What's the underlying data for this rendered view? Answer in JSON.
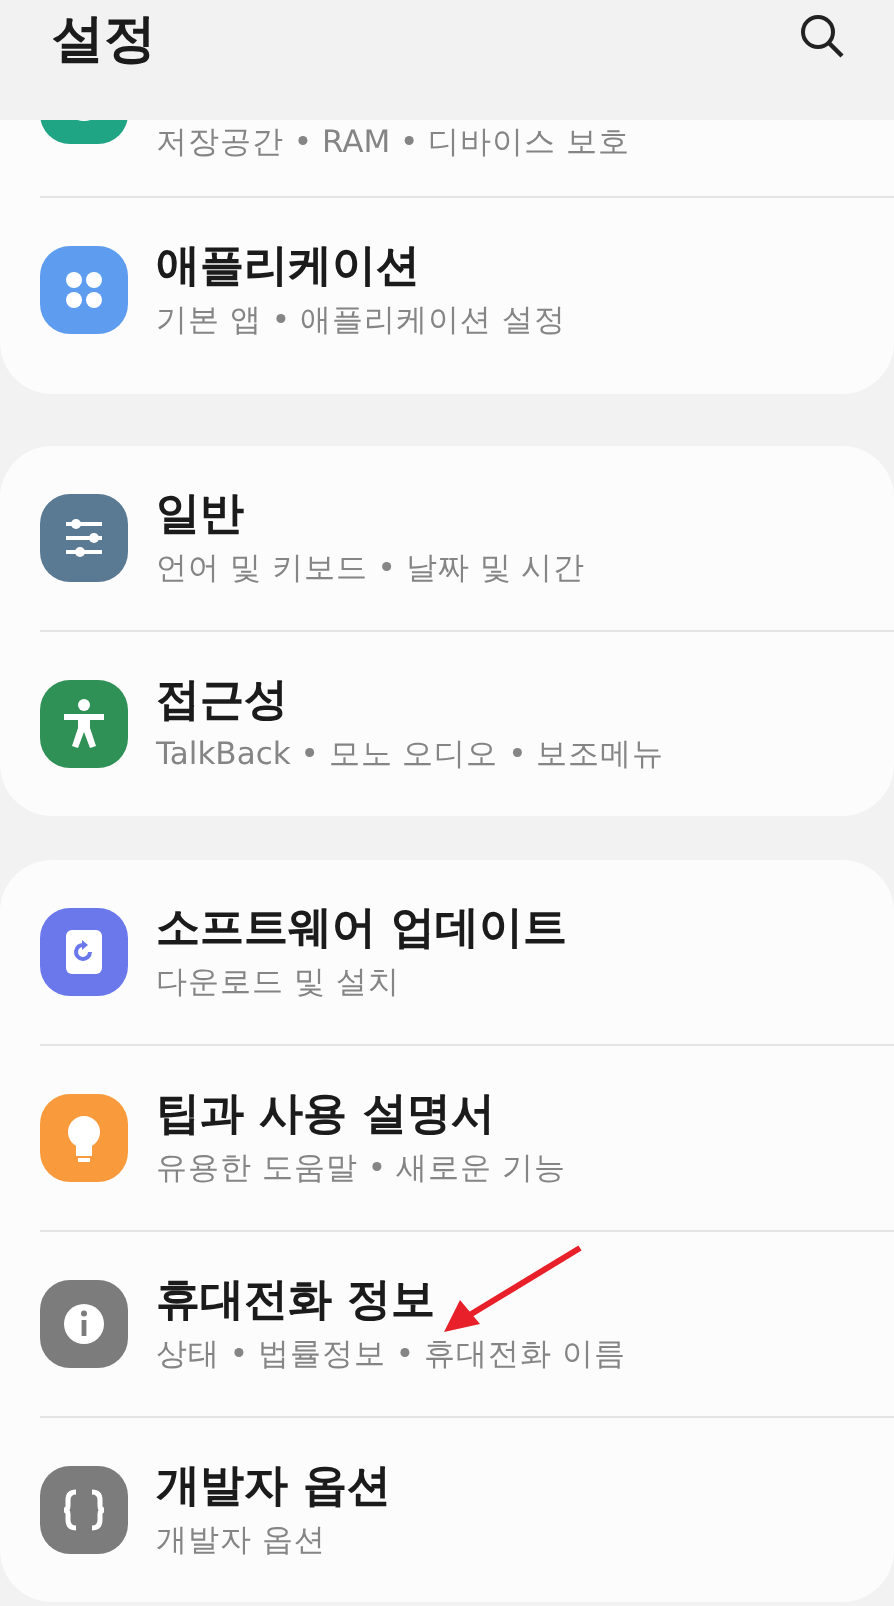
{
  "header": {
    "title": "설정"
  },
  "groups": [
    {
      "items": [
        {
          "kind": "storage",
          "partial": true,
          "subtitle": "저장공간 • RAM • 디바이스 보호"
        },
        {
          "kind": "apps",
          "title": "애플리케이션",
          "subtitle": "기본 앱 • 애플리케이션 설정"
        }
      ]
    },
    {
      "items": [
        {
          "kind": "general",
          "title": "일반",
          "subtitle": "언어 및 키보드 • 날짜 및 시간"
        },
        {
          "kind": "accessibility",
          "title": "접근성",
          "subtitle": "TalkBack • 모노 오디오 • 보조메뉴"
        }
      ]
    },
    {
      "items": [
        {
          "kind": "update",
          "title": "소프트웨어 업데이트",
          "subtitle": "다운로드 및 설치"
        },
        {
          "kind": "tips",
          "title": "팁과 사용 설명서",
          "subtitle": "유용한 도움말 • 새로운 기능"
        },
        {
          "kind": "info",
          "title": "휴대전화 정보",
          "subtitle": "상태 • 법률정보 • 휴대전화 이름",
          "pointed": true
        },
        {
          "kind": "developer",
          "title": "개발자 옵션",
          "subtitle": "개발자 옵션"
        }
      ]
    }
  ]
}
